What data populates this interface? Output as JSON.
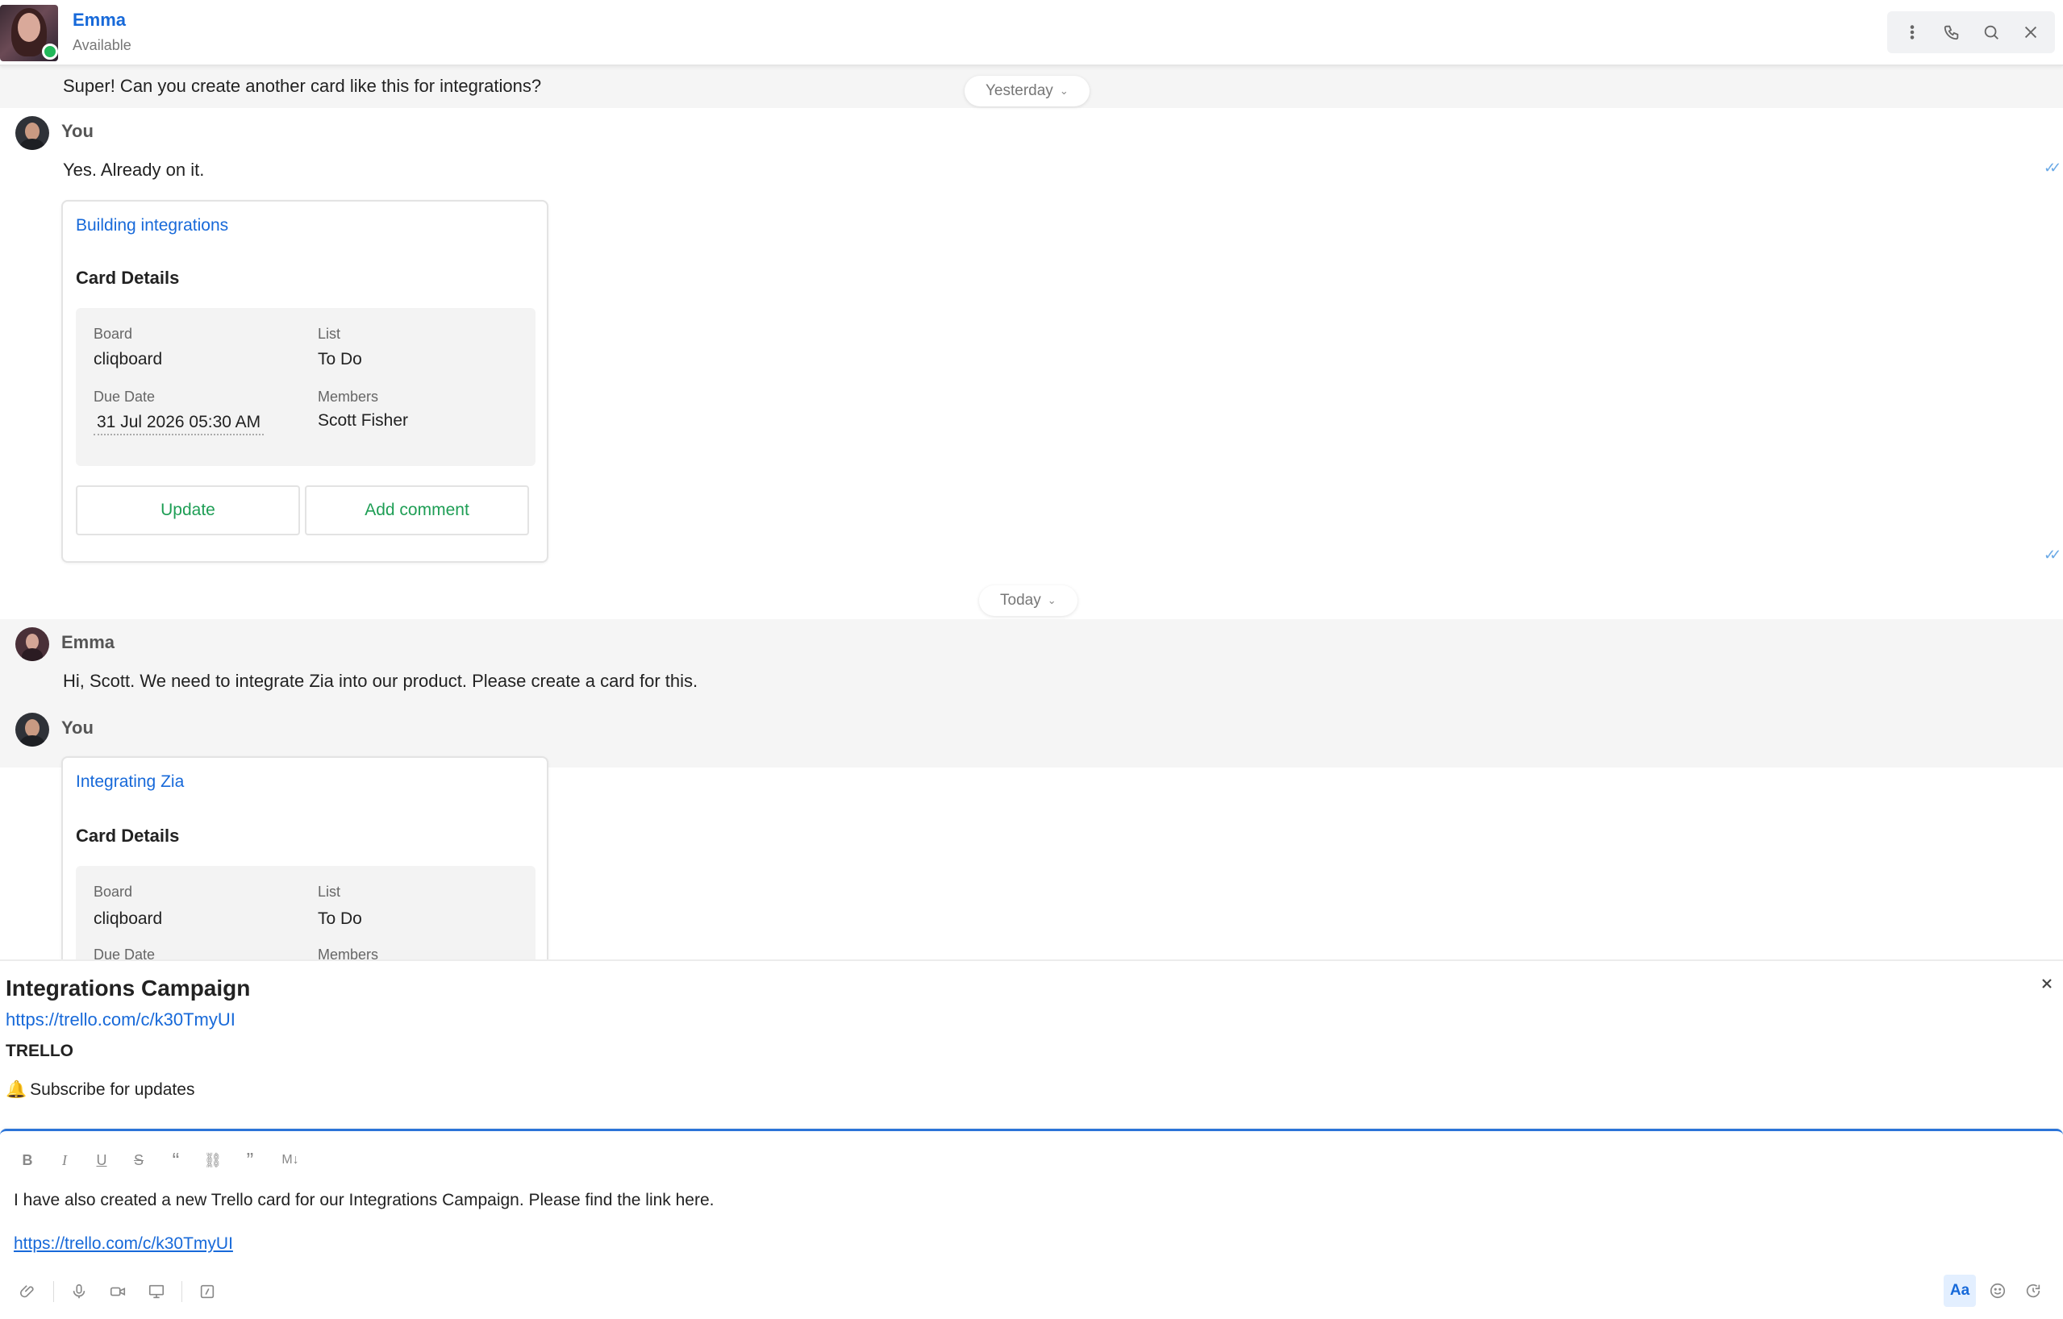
{
  "header": {
    "name": "Emma",
    "status": "Available"
  },
  "chat": {
    "prev_message": "Super! Can you create another card like this for integrations?",
    "date_yesterday": "Yesterday",
    "date_today": "Today",
    "messages": [
      {
        "sender": "You",
        "text": "Yes. Already on it.",
        "card": {
          "link": "Building integrations",
          "heading": "Card Details",
          "board_label": "Board",
          "board": "cliqboard",
          "list_label": "List",
          "list": "To Do",
          "due_label": "Due Date",
          "due": "31 Jul 2026 05:30 AM",
          "members_label": "Members",
          "members": "Scott Fisher",
          "update_btn": "Update",
          "comment_btn": "Add comment"
        }
      },
      {
        "sender": "Emma",
        "text": "Hi, Scott. We need to integrate Zia into our product. Please create a card for this."
      },
      {
        "sender": "You",
        "card": {
          "link": "Integrating Zia",
          "heading": "Card Details",
          "board_label": "Board",
          "board": "cliqboard",
          "list_label": "List",
          "list": "To Do",
          "due_label": "Due Date",
          "members_label": "Members"
        }
      }
    ]
  },
  "preview": {
    "title": "Integrations Campaign",
    "url": "https://trello.com/c/k30TmyUI",
    "source": "TRELLO",
    "subscribe": "Subscribe for updates",
    "subscribe_icon": "🔔"
  },
  "composer": {
    "text": "I have also created a new Trello card for our Integrations Campaign. Please find the link here.",
    "link": "https://trello.com/c/k30TmyUI",
    "format_buttons": [
      "B",
      "I",
      "U",
      "S",
      "“",
      "⛓",
      "”",
      "M↓"
    ],
    "font_toggle": "Aa"
  },
  "colors": {
    "accent": "#1769d9",
    "action_green": "#1e9e55",
    "presence": "#22b85a"
  }
}
